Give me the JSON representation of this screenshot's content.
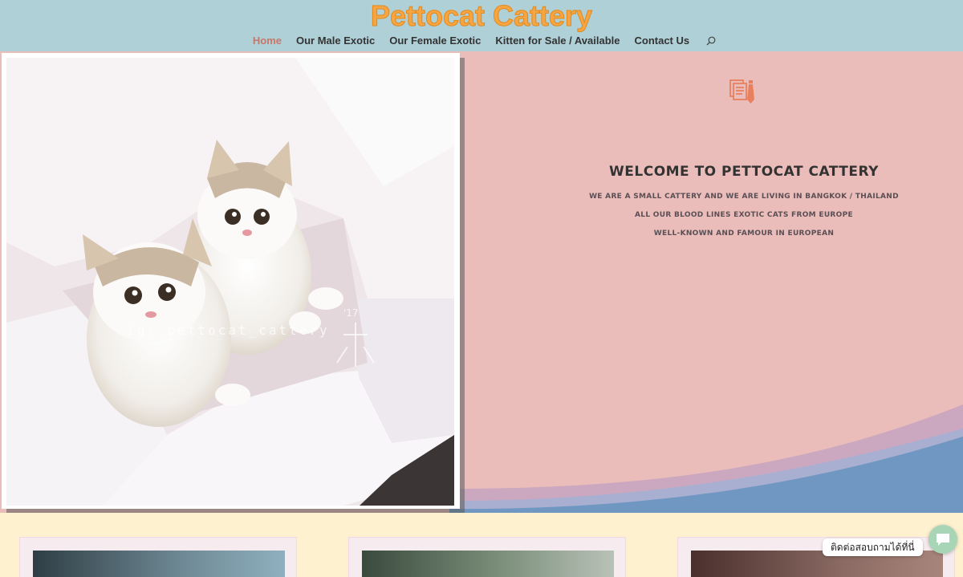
{
  "site": {
    "title": "Pettocat Cattery"
  },
  "nav": {
    "items": [
      {
        "label": "Home",
        "active": true
      },
      {
        "label": "Our Male Exotic"
      },
      {
        "label": "Our Female Exotic"
      },
      {
        "label": "Kitten for Sale / Available"
      },
      {
        "label": "Contact Us"
      }
    ],
    "search_icon": "search-icon"
  },
  "hero": {
    "photo_watermark": "ig: pettocat_cattery",
    "photo_year": "'17",
    "icon": "document-tie-icon",
    "heading": "WELCOME TO PETTOCAT CATTERY",
    "lines": [
      "WE ARE A SMALL CATTERY AND WE ARE LIVING IN BANGKOK / THAILAND",
      "ALL OUR BLOOD LINES EXOTIC CATS FROM EUROPE",
      "WELL-KNOWN AND FAMOUR IN EUROPEAN"
    ]
  },
  "chat": {
    "label": "ติดต่อสอบถามได้ที่นี่",
    "icon": "chat-bubble-icon"
  },
  "colors": {
    "header_bg": "#b0d0d8",
    "logo": "#f6a542",
    "hero_bg": "#ebbdba",
    "wave_blue": "#6f97c2",
    "footer_bg": "#fdf1cf"
  }
}
